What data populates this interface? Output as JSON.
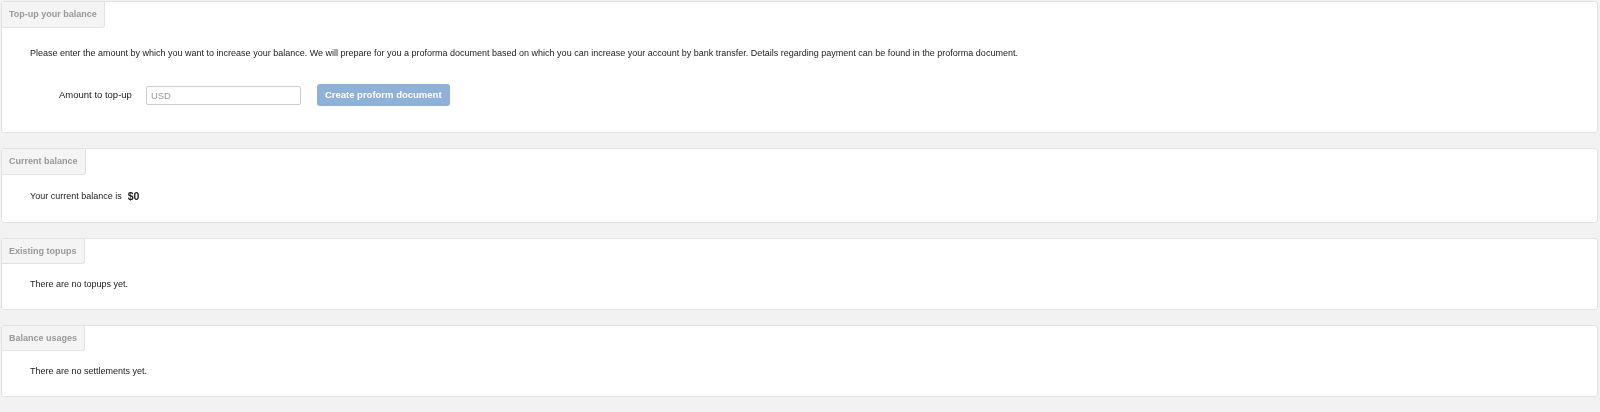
{
  "panels": [
    {
      "kind": "topup",
      "title": "Top-up your balance",
      "intro": "Please enter the amount by which you want to increase your balance. We will prepare for you a proforma document based on which you can increase your account by bank transfer. Details regarding payment can be found in the proforma document.",
      "field_label": "Amount to top-up",
      "field": {
        "placeholder": "USD"
      },
      "button": {
        "label": "Create proform document",
        "disabled": true
      }
    },
    {
      "kind": "balance",
      "title": "Current balance",
      "text": "Your current balance is",
      "amount": "$0"
    },
    {
      "kind": "message",
      "title": "Existing topups",
      "text": "There are no topups yet."
    },
    {
      "kind": "message",
      "title": "Balance usages",
      "text": "There are no settlements yet."
    }
  ]
}
